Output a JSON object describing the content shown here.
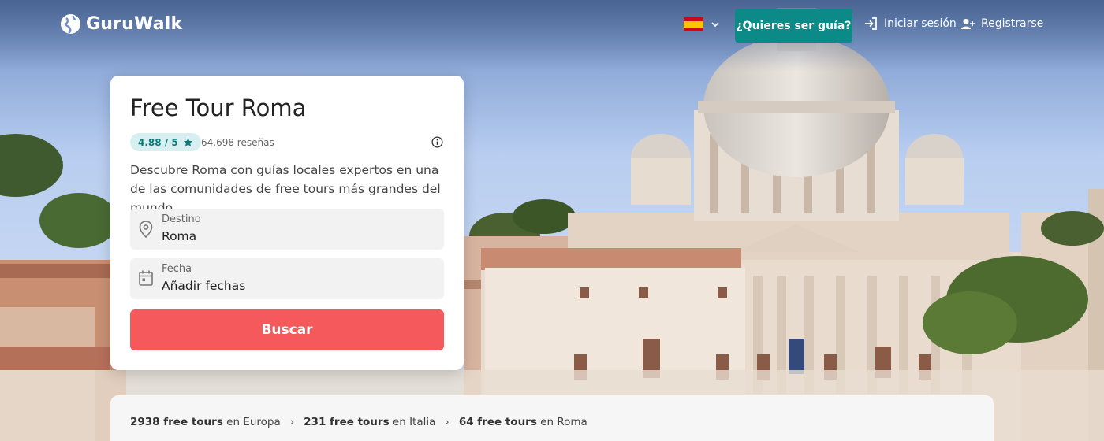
{
  "header": {
    "logo_text": "GuruWalk",
    "guide_button": "¿Quieres ser guía?",
    "login": "Iniciar sesión",
    "register": "Registrarse"
  },
  "card": {
    "title": "Free Tour Roma",
    "rating": "4.88 / 5",
    "reviews": "64.698 reseñas",
    "description": "Descubre Roma con guías locales expertos en una de las comunidades de free tours más grandes del mundo.",
    "destination_label": "Destino",
    "destination_value": "Roma",
    "date_label": "Fecha",
    "date_value": "Añadir fechas",
    "search_button": "Buscar"
  },
  "breadcrumbs": [
    {
      "bold": "2938 free tours",
      "rest": " en Europa"
    },
    {
      "bold": "231 free tours",
      "rest": " en Italia"
    },
    {
      "bold": "64 free tours",
      "rest": " en Roma"
    }
  ],
  "colors": {
    "teal": "#0b8a88",
    "coral": "#f5595c",
    "badge_bg": "#d7eff0"
  },
  "icons": {
    "logo": "globe-icon",
    "language": "spain-flag-icon",
    "login": "sign-in-icon",
    "register": "add-user-icon",
    "info": "info-icon",
    "destination": "location-pin-icon",
    "date": "calendar-icon",
    "rating": "star-icon"
  }
}
